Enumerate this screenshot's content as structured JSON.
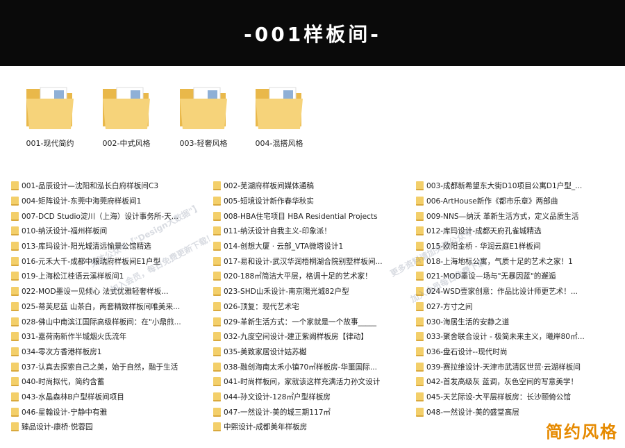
{
  "header": {
    "title": "-001样板间-"
  },
  "folders": [
    {
      "label": "001-现代简约"
    },
    {
      "label": "002-中式风格"
    },
    {
      "label": "003-轻奢风格"
    },
    {
      "label": "004-混搭风格"
    }
  ],
  "list": {
    "col1": [
      "001-品辰设计—沈阳和泓长白府样板间C3",
      "004-矩阵设计-东莞中海莞府样板间1",
      "007-DCD Studio淀川（上海）设计事务所-天...",
      "010-纳沃设计-福州样板间",
      "013-库玛设计-阳光城清远愉景公馆精选",
      "016-元禾大千-成都中粮瑞府样板间E1户型",
      "019-上海松江桂语云溪样板间1",
      "022-MOD墨设一见倾心 法式优雅轻奢样板...",
      "025-蒂芙尼蓝 山茶白，两套精致样板间唯美来...",
      "028-佛山中南滨江国际高级样板间：在\"小鼎煎...",
      "031-嘉荷南新作半城烟火氐流年",
      "034-零次方香港样板房1",
      "037-认真去探索自己之美，始于自然，融于生活",
      "040-时尚拟代，简约含蓄",
      "043-水晶森林B户型样板间项目",
      "046-星翰设计-宁静中有雅",
      "臻品设计-康桥·悦蓉园"
    ],
    "col2": [
      "002-芜湖府样板间媒体通稿",
      "005-短境设计新作春华秋实",
      "008-HBA住宅项目 HBA Residential Projects",
      "011-纳沃设计自我主义-印象派！",
      "014-创想大厦 · 云部_VTA微塔设计1",
      "017-易和设计-武汉华润梧桐湖合院别墅样板间...",
      "020-188㎡简洁大平层，格调十足的艺术家！",
      "023-SHD山禾设计-南京陽光城82户型",
      "026-顶复：现代艺术宅",
      "029-革新生活方式：一个家就是一个故事_____",
      "032-九度空间设计-建正紫阙样板房【律动】",
      "035-美致家居设计姑苏樾",
      "038-融创海南太禾小镇70㎡样板房-华噩国际...",
      "041-时尚样板间，家就该这样充满活力孙文设计",
      "044-孙文设计-128㎡户型样板房",
      "047-一然设计-美的城三期117㎡",
      "中熙设计-成都美年样板房"
    ],
    "col3": [
      "003-成都新希望东大街D10项目公寓D1户型_...",
      "006-ArtHouse新作《都市乐章》两部曲",
      "009-NNS—纳沃  革新生活方式，定义品质生活",
      "012-库玛设计-成都天府孔雀城精选",
      "015-欧阳金桥 - 华润云庭E1样板间",
      "018-上海地标公寓，气质十足的艺术之家！1",
      "021-MOD墨设—场与\"无暴因蓝\"的邂逅",
      "024-WSD壹家创意：作品比设计师更艺术！...",
      "027-方寸之间",
      "030-海居生活的安静之道",
      "033-聚舍联合设计 - 极简未来主义，曦岸80㎡...",
      "036-盘石设计--现代时尚",
      "039-赛拉维设计-天津市武清区世贸·云湖样板间",
      "042-首发高级灰 蓝调，灰色空间的写意美学！",
      "045-天艺际设-大平层样板房：长沙颐倚公馆",
      "048-一然设计-美的盛堂高层"
    ]
  },
  "footer_tag": "简约风格",
  "watermarks": [
    "关注公众号【\"Design大数据\"】",
    "加入会员，每日免费更新下载！",
    "更多资料请加关注公众号",
    "加入会员每日免费下载"
  ],
  "colors": {
    "header_bg": "#0a0a0a",
    "accent": "#e68a00",
    "folder": "#f3cf6a"
  }
}
